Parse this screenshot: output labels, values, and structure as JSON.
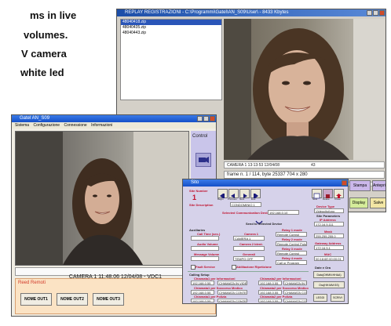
{
  "caption": {
    "line1": "ms in live",
    "line2": "volumes.",
    "line3": "V camera",
    "line4": "white led"
  },
  "replay_window": {
    "title": "REPLAY REGISTRAZIONI - C:\\Programmi\\Gatel\\AN_S09\\User\\ - 8433 Kbytes",
    "files": [
      "48040418.zip",
      "48040435.zip",
      "48040443.zip"
    ],
    "status_text": "CAMERA  1 13:13:53 12/04/08",
    "status_value": "43",
    "frame_info": "frame n. 1 / 114,  byte 25337   704 x 280",
    "buttons": {
      "stampa": "Stampa",
      "anteprima": "Anteprim",
      "display": "Display",
      "salva": "Salve"
    }
  },
  "main_window": {
    "title": "Gatel AN_S09",
    "menu": [
      "Sistema",
      "Configurazione",
      "Connessione",
      "Informazioni"
    ],
    "control_label": "Control",
    "camera_status": "CAMERA  1 11.48.06 12/04/08  -  VDC1",
    "reed_label": "Reed Remoti",
    "outputs": [
      "NOME OUT1",
      "NOME OUT2",
      "NOME OUT3"
    ]
  },
  "site_window": {
    "title": "Sito",
    "site_number_label": "Site Number",
    "site_number": "1",
    "nav": [
      "Begin",
      "Previous",
      "Next",
      "End"
    ],
    "right_nav": [
      "New",
      "Delete",
      "Close"
    ],
    "site_description_label": "Site Description",
    "site_description_value": "CONDOMINIO 1",
    "device_type_label": "Device Type",
    "device_type_value": "Videocitofono",
    "site_parameters_label": "Site Parameters",
    "ip_label": "IP Address",
    "ip_value": "172.16.5.111",
    "mask_label": "Mask",
    "mask_value": "255.255.255.0",
    "gateway_label": "Gateway Address",
    "gateway_value": "172.16.5.1",
    "mac_label": "MAC",
    "mac_value": "00:18:6E:00:00:01",
    "date_label": "Date e Ora",
    "date_btn1": "Data(OHMN:HHAA)",
    "date_btn2": "Ora(HH:MM:SS)",
    "selected_comm_label": "Selected Communication Device",
    "selected_comm_value": "192.168.0.10",
    "send_label": "Send to Selected Device",
    "auxiliaries_label": "Auxiliaries",
    "call_time_label": "Call Time (sec.)",
    "audio_volume_label": "Audio Volume",
    "message_volume_label": "Message Volume",
    "camera1_label": "Camera 1",
    "camera1_value": "CAMERA 1",
    "camera2_label": "Camera 2 Ident.",
    "camera2_value": "",
    "generali_label": "Generali",
    "generali_value": "TEMPO OFF",
    "relay1_label": "Relay 1 mode",
    "relay1_value": "Remote Control",
    "relay2_label": "Relay 2 mode",
    "relay2_value": "Remote Control Pulse",
    "relay3_label": "Relay 3 mode",
    "relay3_value": "Remote Control",
    "relay4_label": "Relay 4 mode",
    "relay4_value": "Call or Program",
    "fault_label": "Fault Service",
    "alarm_label": "Abilitazione Ripetizione",
    "calling_setup_label": "Calling Setup",
    "calls_left": [
      "Chiamata1 per Informazioni",
      "Chiamata1 per Soccorso Medico",
      "Chiamata1 per Polizia",
      "Chiamata1 per Informazioni"
    ],
    "calls_right": [
      "Chiamata2 per Informazioni",
      "Chiamata2 per Soccorso Medico",
      "Chiamata2 per Polizia",
      "Chiamata2 per Informazioni"
    ],
    "call_number": "192.168.0.55",
    "call_select": "CHIAMATA IN VIDEOCONFERENZA",
    "call_select_alt": "CHIAMATA CONTEMPORANEA",
    "bottom_btn1": "LEGGI",
    "bottom_btn2": "SCRIVI"
  },
  "colors": {
    "title_blue": "#1c4ea8",
    "red_label": "#c0102c",
    "panel_purple": "#b9b7e0",
    "panel_lilac": "#d6d2ea",
    "reed_red": "#e0433d"
  }
}
